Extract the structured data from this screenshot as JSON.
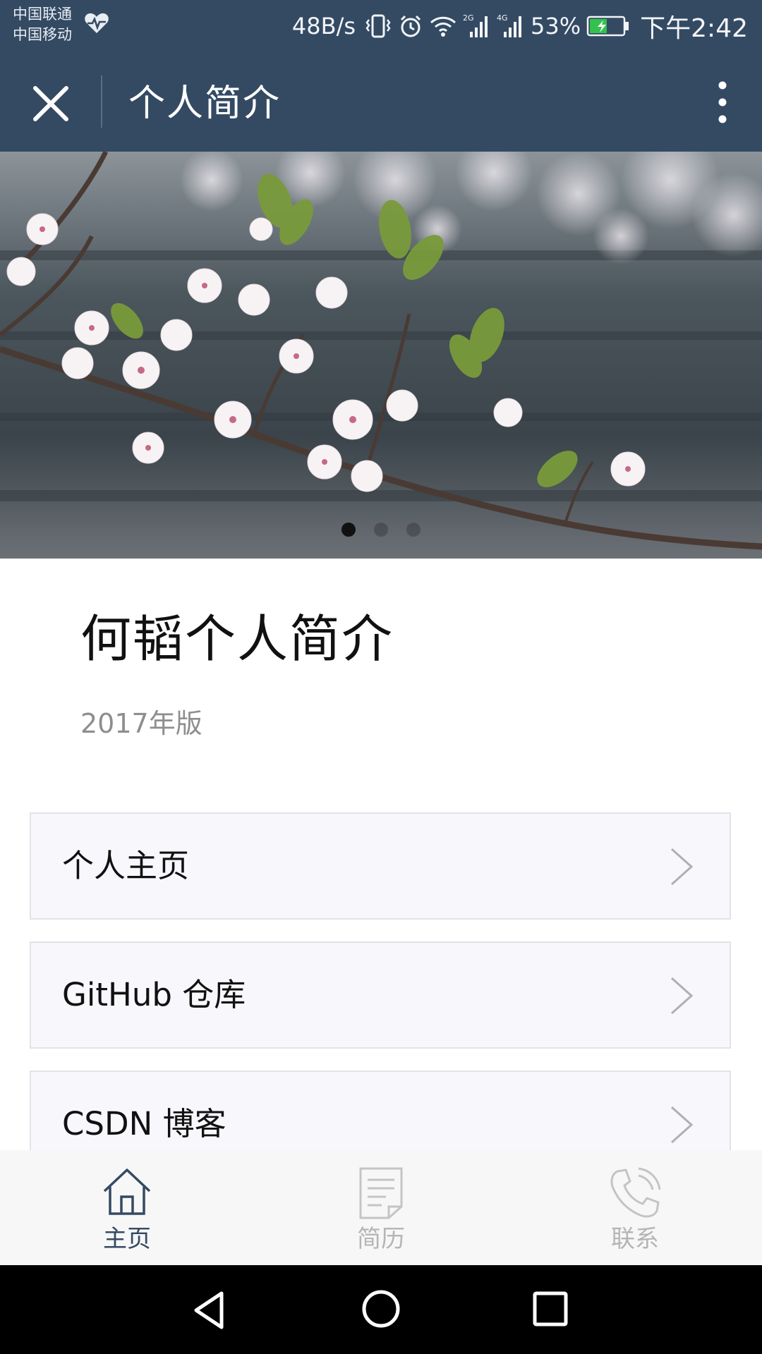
{
  "status_bar": {
    "carrier_1": "中国联通",
    "carrier_2": "中国移动",
    "net_speed": "48B/s",
    "battery_percent": "53%",
    "time": "下午2:42",
    "icons": [
      "heart-rate-icon",
      "vibrate-icon",
      "alarm-icon",
      "wifi-icon",
      "signal-2g-icon",
      "signal-4g-icon",
      "battery-charging-icon"
    ],
    "battery_level": 0.53
  },
  "nav_bar": {
    "title": "个人简介",
    "close_icon": "close-icon",
    "more_icon": "more-vertical-icon",
    "background": "#344a63"
  },
  "banner": {
    "image": "cherry-blossom-branch",
    "slide_count": 3,
    "active_slide": 1
  },
  "header": {
    "title": "何韬个人简介",
    "subtitle": "2017年版"
  },
  "menu": {
    "items": [
      {
        "label": "个人主页",
        "icon": "chevron-right-icon"
      },
      {
        "label": "GitHub 仓库",
        "icon": "chevron-right-icon"
      },
      {
        "label": "CSDN 博客",
        "icon": "chevron-right-icon"
      }
    ]
  },
  "tab_bar": {
    "tabs": [
      {
        "label": "主页",
        "icon": "home-icon",
        "active": true
      },
      {
        "label": "简历",
        "icon": "resume-icon",
        "active": false
      },
      {
        "label": "联系",
        "icon": "phone-icon",
        "active": false
      }
    ],
    "active_color": "#344a63",
    "inactive_color": "#b5b5b5"
  },
  "system_nav": {
    "icons": [
      "back-icon",
      "home-circle-icon",
      "recents-icon"
    ]
  }
}
